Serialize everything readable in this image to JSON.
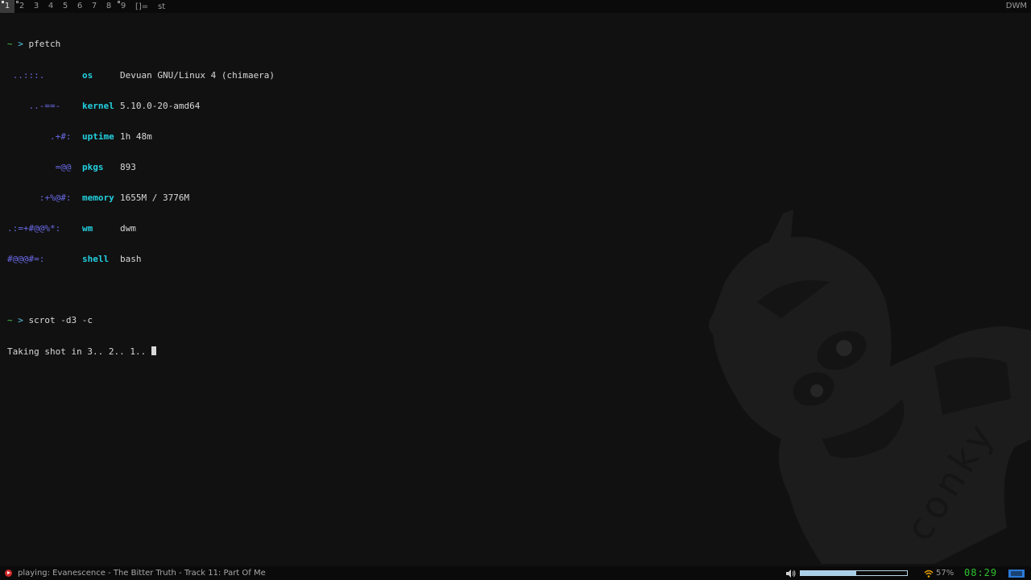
{
  "topbar": {
    "tags": [
      "1",
      "2",
      "3",
      "4",
      "5",
      "6",
      "7",
      "8",
      "9"
    ],
    "layout": "[]=",
    "window_title": "st",
    "wm_name": "DWM"
  },
  "terminal": {
    "prompt_tilde": "~",
    "prompt_arrow": ">",
    "cmd1": "pfetch",
    "pfetch": [
      {
        "logo": " ..:::.",
        "key": "os",
        "value": "Devuan GNU/Linux 4 (chimaera)"
      },
      {
        "logo": "    ..-==-",
        "key": "kernel",
        "value": "5.10.0-20-amd64"
      },
      {
        "logo": "        .+#:",
        "key": "uptime",
        "value": "1h 48m"
      },
      {
        "logo": "         =@@",
        "key": "pkgs",
        "value": "893"
      },
      {
        "logo": "      :+%@#:",
        "key": "memory",
        "value": "1655M / 3776M"
      },
      {
        "logo": ".:=+#@@%*:",
        "key": "wm",
        "value": "dwm"
      },
      {
        "logo": "#@@@#=:",
        "key": "shell",
        "value": "bash"
      }
    ],
    "cmd2": "scrot -d3 -c",
    "output": "Taking shot in 3.. 2.. 1.. "
  },
  "wallpaper": {
    "text": "conky"
  },
  "bottombar": {
    "now_playing": "playing: Evanescence - The Bitter Truth - Track 11: Part Of Me",
    "volume_level": 0.52,
    "wifi_percent": "57%",
    "clock": "08:29",
    "colors": {
      "clock": "#2ec42e",
      "volume": "#a8d0ea",
      "wifi": "#e8a000",
      "logo": "#2a7ad8"
    }
  }
}
